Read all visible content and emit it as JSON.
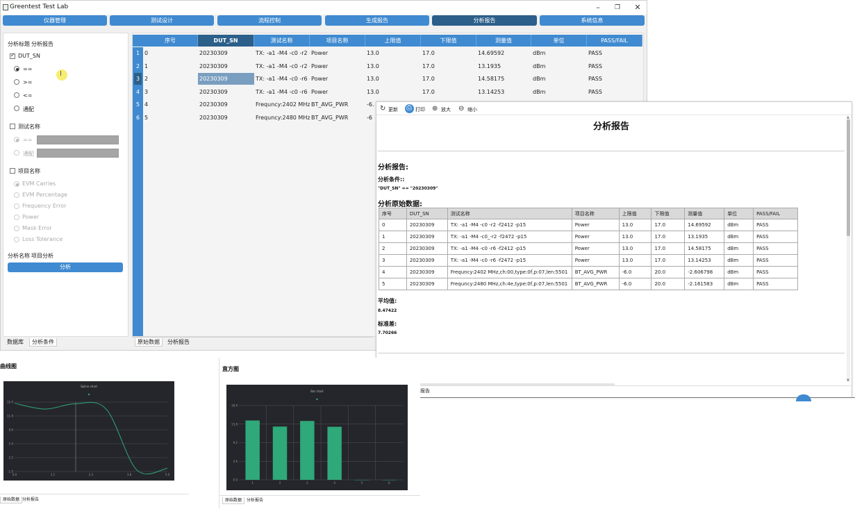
{
  "app": {
    "title": "Greentest Test Lab"
  },
  "window_controls": {
    "minimize": "–",
    "restore": "❐",
    "close": "✕"
  },
  "nav": [
    {
      "label": "仪器管理"
    },
    {
      "label": "测试设计"
    },
    {
      "label": "流程控制"
    },
    {
      "label": "生成报告"
    },
    {
      "label": "分析报告"
    },
    {
      "label": "系统信息"
    }
  ],
  "left_panel": {
    "analysis_title_label": "分析标题",
    "analysis_title_value": "分析报告",
    "dut_sn_label": "DUT_SN",
    "dut_ops": [
      "==",
      ">=",
      "<=",
      "通配"
    ],
    "test_name_label": "测试名称",
    "test_name_ops": [
      "==",
      "通配"
    ],
    "item_name_label": "项目名称",
    "item_options": [
      "EVM Carries",
      "EVM Percentage",
      "Frequency Error",
      "Power",
      "Mask Error",
      "Loss Tolerance"
    ],
    "analysis_name_label": "分析名称",
    "analysis_name_value": "项目分析",
    "analyze_button": "分析",
    "tabs": [
      "数据库",
      "分析条件"
    ]
  },
  "data_table": {
    "headers": [
      "序号",
      "DUT_SN",
      "测试名称",
      "项目名称",
      "上限值",
      "下限值",
      "测量值",
      "单位",
      "PASS/FAIL"
    ],
    "row_numbers": [
      "1",
      "2",
      "3",
      "4",
      "5",
      "6"
    ],
    "rows": [
      [
        "0",
        "20230309",
        "TX: -a1 -M4 -c0 -r2 -...",
        "Power",
        "13.0",
        "17.0",
        "14.69592",
        "dBm",
        "PASS"
      ],
      [
        "1",
        "20230309",
        "TX: -a1 -M4 -c0 -r2 -...",
        "Power",
        "13.0",
        "17.0",
        "13.1935",
        "dBm",
        "PASS"
      ],
      [
        "2",
        "20230309",
        "TX: -a1 -M4 -c0 -r6 -...",
        "Power",
        "13.0",
        "17.0",
        "14.58175",
        "dBm",
        "PASS"
      ],
      [
        "3",
        "20230309",
        "TX: -a1 -M4 -c0 -r6 -...",
        "Power",
        "13.0",
        "17.0",
        "13.14253",
        "dBm",
        "PASS"
      ],
      [
        "4",
        "20230309",
        "Frequncy:2402 MHz,c...",
        "BT_AVG_PWR",
        "-6.",
        "",
        "",
        "",
        ""
      ],
      [
        "5",
        "20230309",
        "Frequncy:2480 MHz,c...",
        "BT_AVG_PWR",
        "-6",
        "",
        "",
        "",
        ""
      ]
    ],
    "tabs": [
      "原始数据",
      "分析报告"
    ]
  },
  "report": {
    "toolbar": [
      {
        "icon": "refresh-icon",
        "glyph": "↻",
        "label": "更新"
      },
      {
        "icon": "print-icon",
        "glyph": "⎙",
        "label": "打印"
      },
      {
        "icon": "zoom-in-icon",
        "glyph": "⊕",
        "label": "放大"
      },
      {
        "icon": "zoom-out-icon",
        "glyph": "⊖",
        "label": "缩小"
      }
    ],
    "title": "分析报告",
    "section_report": "分析报告:",
    "conditions_label": "分析条件::",
    "conditions_value": "\"DUT_SN\" == \"20230309\"",
    "raw_data_label": "分析原始数据:",
    "table_headers": [
      "序号",
      "DUT_SN",
      "测试名称",
      "项目名称",
      "上限值",
      "下限值",
      "测量值",
      "单位",
      "PASS/FAIL"
    ],
    "table_rows": [
      [
        "0",
        "20230309",
        "TX: -a1 -M4 -c0 -r2 -f2412 -p15",
        "Power",
        "13.0",
        "17.0",
        "14.69592",
        "dBm",
        "PASS"
      ],
      [
        "1",
        "20230309",
        "TX: -a1 -M4 -c0_-r2 -f2472 -p15",
        "Power",
        "13.0",
        "17.0",
        "13.1935",
        "dBm",
        "PASS"
      ],
      [
        "2",
        "20230309",
        "TX: -a1 -M4 -c0 -r6 -f2412 -p15",
        "Power",
        "13.0",
        "17.0",
        "14.58175",
        "dBm",
        "PASS"
      ],
      [
        "3",
        "20230309",
        "TX: -a1 -M4 -c0 -r6 -f2472 -p15",
        "Power",
        "13.0",
        "17.0",
        "13.14253",
        "dBm",
        "PASS"
      ],
      [
        "4",
        "20230309",
        "Frequncy:2402 MHz,ch:00,type:0f,p:07,len:5501",
        "BT_AVG_PWR",
        "-6.0",
        "20.0",
        "-2.606798",
        "dBm",
        "PASS"
      ],
      [
        "5",
        "20230309",
        "Frequncy:2480 MHz,ch:4e,type:0f,p:07,len:5501",
        "BT_AVG_PWR",
        "-6.0",
        "20.0",
        "-2.161583",
        "dBm",
        "PASS"
      ]
    ],
    "mean_label": "平均值:",
    "mean_value": "8.47422",
    "std_label": "标准差:",
    "std_value": "7.70266",
    "bottom_tab": "报告"
  },
  "curve_window": {
    "title": "曲线图",
    "tabs": [
      "原始数据",
      "分析报告"
    ]
  },
  "bar_window": {
    "title": "直方图",
    "tabs": [
      "原始数据",
      "分析报告"
    ]
  },
  "chart_data": [
    {
      "type": "line",
      "title": "Spline chart",
      "x": [
        0,
        1,
        2,
        3,
        4,
        5
      ],
      "series": [
        {
          "values": [
            14.69592,
            13.1935,
            14.58175,
            13.14253,
            -2.606798,
            -2.161583
          ]
        }
      ],
      "xticks": [
        "0.0",
        "1.1",
        "2.3",
        "3.8",
        "5.0"
      ],
      "yticks": [
        "15.0",
        "11.8",
        "8.6",
        "5.4",
        "2.2",
        "-1.0"
      ],
      "ylim": [
        -3,
        15
      ],
      "color": "#2fa87a"
    },
    {
      "type": "bar",
      "title": "Bar chart",
      "categories": [
        "1",
        "2",
        "3",
        "4",
        "5",
        "6"
      ],
      "values": [
        14.69592,
        13.1935,
        14.58175,
        13.14253,
        0,
        0
      ],
      "yticks": [
        "18.4",
        "13.8",
        "9.2",
        "4.6",
        "0.0"
      ],
      "ylim": [
        0,
        18.4
      ],
      "color": "#2fa87a"
    }
  ]
}
